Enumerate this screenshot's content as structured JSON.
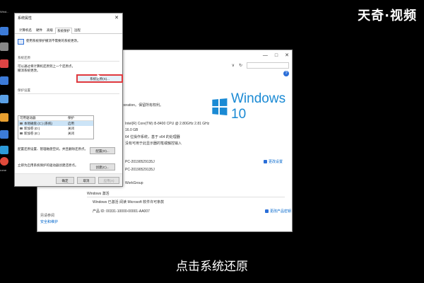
{
  "watermark": "天奇·视频",
  "subtitle": "点击系统还原",
  "desktop": {
    "labels": [
      "Wind...",
      "",
      "",
      "",
      "",
      "",
      "",
      "",
      "rome"
    ]
  },
  "system_window": {
    "titlebar": {
      "minimize": "—",
      "maximize": "□",
      "close": "✕"
    },
    "address": {
      "chevron": "∨",
      "refresh": "↻"
    },
    "help": "?",
    "windows_brand": "Windows 10",
    "lines": {
      "license_text": "poration。保留所有权利。",
      "cpu": "Intel(R) Core(TM) i5-8400 CPU @ 2.80GHz   2.81 GHz",
      "ram": "16.0 GB",
      "sys_type": "64 位操作系统，基于 x64 的处理器",
      "pen": "没有可用于此显示器的笔或触控输入",
      "computer_name": "PC-20190529135J",
      "full_name": "PC-20190529135J",
      "workgroup": "WorkGroup",
      "activation_header": "Windows 激活",
      "activation": "Windows 已激活   阅读 Microsoft 软件许可条款",
      "product_id": "产品 ID: 00331-10000-00001-AA007"
    },
    "change_settings": "更改设置",
    "change_key": "更改产品密钥",
    "left_nav": {
      "see_also": "另请参阅",
      "security": "安全和维护"
    }
  },
  "dialog": {
    "title": "系统属性",
    "close": "✕",
    "tabs": [
      "计算机名",
      "硬件",
      "高级",
      "系统保护",
      "远程"
    ],
    "active_tab": 3,
    "intro": "使用系统保护撤消不需要的系统更改。",
    "restore_section": "系统还原",
    "restore_desc": "可以通过将计算机还原到上一个还原点，撤消系统更改。",
    "restore_button": "系统还原(S)...",
    "protect_section": "保护设置",
    "table_headers": [
      "可用驱动器",
      "保护"
    ],
    "drives": [
      {
        "name": "本地磁盘 (C:) (系统)",
        "status": "启用"
      },
      {
        "name": "新加卷 (D:)",
        "status": "关闭"
      },
      {
        "name": "新加卷 (E:)",
        "status": "关闭"
      }
    ],
    "config_desc": "配置还原设置、管理磁盘空间，并且删除还原点。",
    "config_button": "配置(O)...",
    "create_desc": "立即为启用系统保护的驱动器创建还原点。",
    "create_button": "创建(C)...",
    "ok": "确定",
    "cancel": "取消",
    "apply": "应用(A)"
  },
  "colors": {
    "accent": "#1a8ad4",
    "highlight_border": "#e0393e",
    "selection": "#cce4f7"
  }
}
